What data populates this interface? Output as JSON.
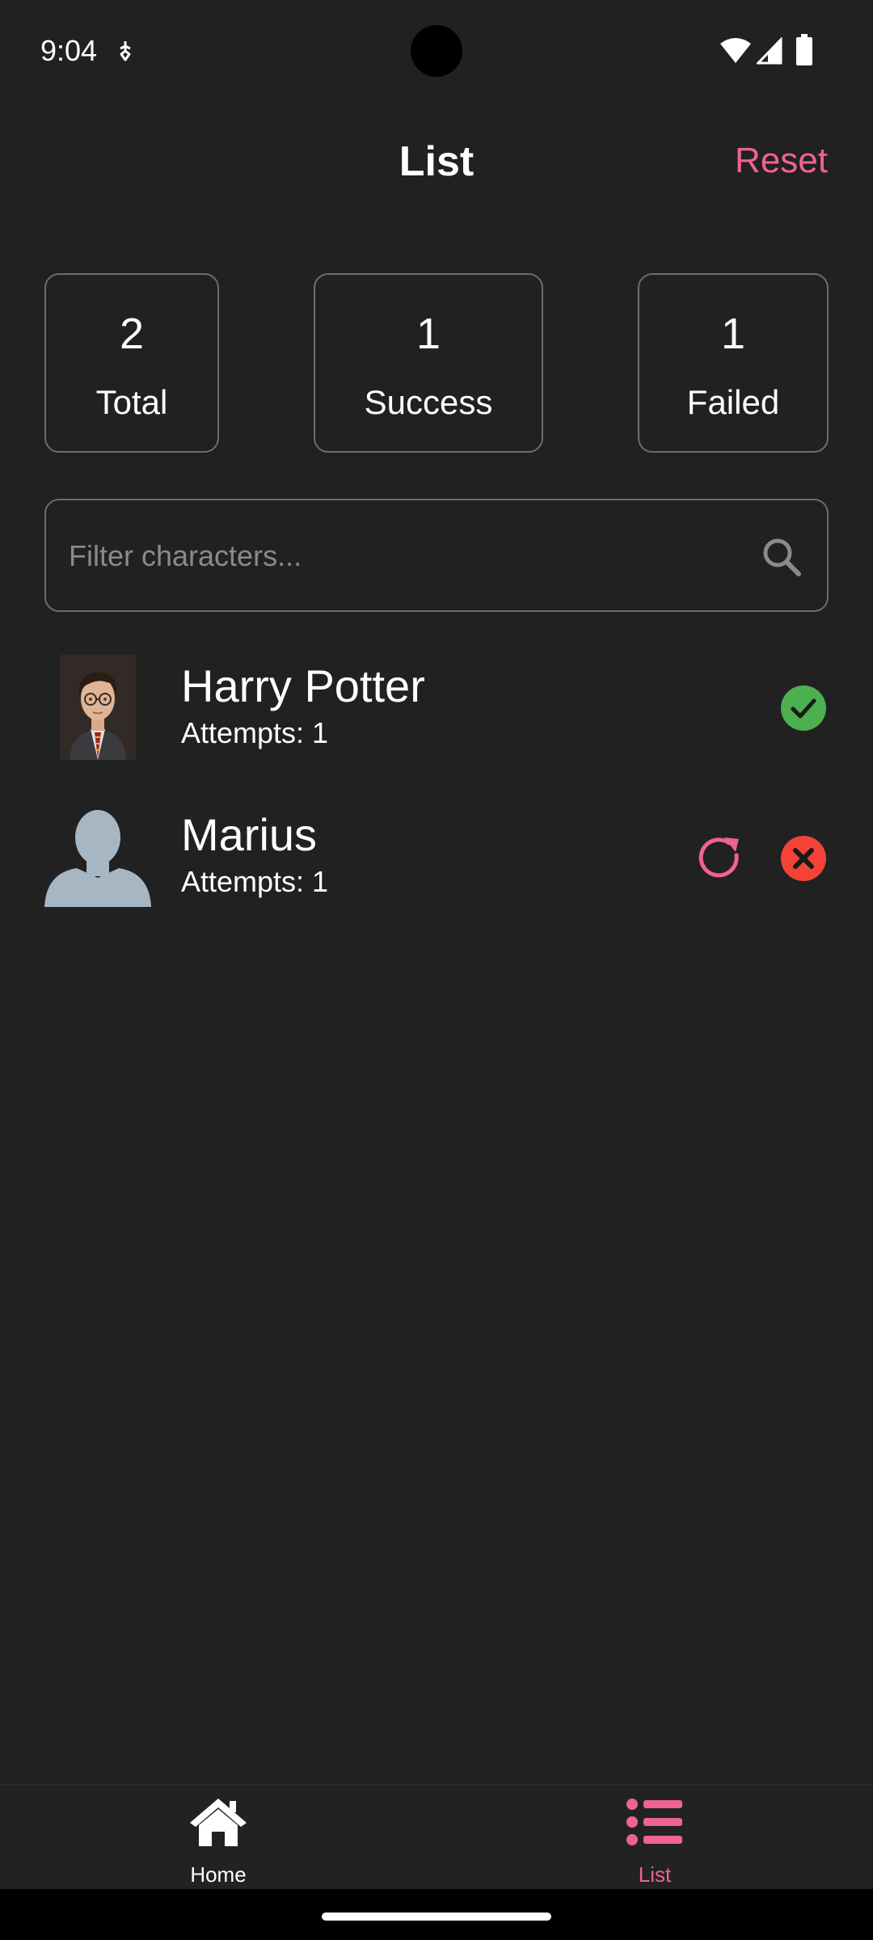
{
  "status_bar": {
    "time": "9:04"
  },
  "header": {
    "title": "List",
    "reset_label": "Reset"
  },
  "stats": [
    {
      "value": "2",
      "label": "Total"
    },
    {
      "value": "1",
      "label": "Success"
    },
    {
      "value": "1",
      "label": "Failed"
    }
  ],
  "search": {
    "placeholder": "Filter characters...",
    "value": ""
  },
  "characters": [
    {
      "name": "Harry Potter",
      "attempts": "Attempts: 1",
      "status": "success"
    },
    {
      "name": "Marius",
      "attempts": "Attempts: 1",
      "status": "failed"
    }
  ],
  "bottom_nav": {
    "items": [
      {
        "label": "Home",
        "icon": "home-icon",
        "active": false
      },
      {
        "label": "List",
        "icon": "list-icon",
        "active": true
      }
    ]
  },
  "colors": {
    "background": "#212121",
    "accent": "#f06292",
    "success": "#4caf50",
    "failed": "#f44336",
    "border": "#6d6d6d",
    "placeholder": "#8a8a8a"
  }
}
